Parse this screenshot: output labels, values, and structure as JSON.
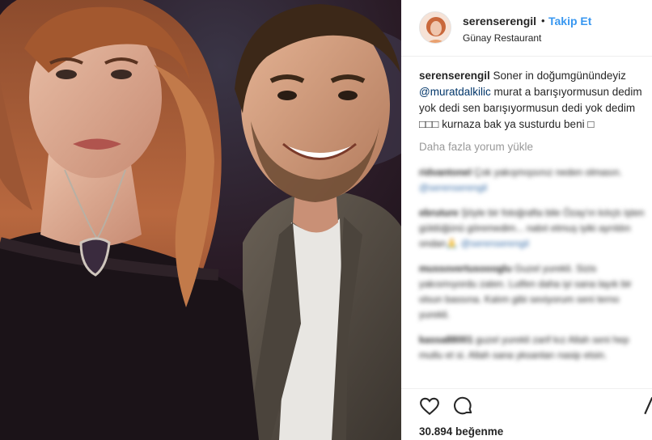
{
  "post": {
    "username": "serenserengil",
    "separator": "•",
    "follow_label": "Takip Et",
    "location": "Günay Restaurant"
  },
  "caption": {
    "username": "serenserengil",
    "text_1": " Soner in doğumgünündeyiz ",
    "mention": "@muratdalkilic",
    "text_2": " murat a barışıyormusun dedim yok dedi sen barışıyormusun dedi yok dedim □□□ kurnaza bak ya susturdu beni □"
  },
  "load_more_label": "Daha fazla yorum yükle",
  "comments": [
    {
      "username": "ridvantoneI",
      "text": " Çok yakışmışsınız neden olmasın. ",
      "mention": "@serenserengil"
    },
    {
      "username": "ebruture",
      "text": " Şöyle bir fotoğrafta bile Özay'ın kılıçtı işten güldüğünü göremedim... nabıt etmuş iyiki ayrıldın ondan🙏 ",
      "mention": "@serenserengil"
    },
    {
      "username": "mussovertusoooglu",
      "text": " Guzel yurekli. Sizis yakısmıyordu zaten. Lutfen daha iyi sana layık bir olsun bassına. Kalım gibi seviyorum seni terno yurekli.",
      "mention": ""
    },
    {
      "username": "kassa88001",
      "text": " guzel yurekli zarif kız Allah seni hep mutlu et si. Allah sana yksanları nasip etsin.",
      "mention": ""
    }
  ],
  "likes_label": "30.894 beğenme",
  "icons": {
    "like": "heart-outline-icon",
    "comment": "comment-bubble-icon",
    "share": "share-icon"
  },
  "colors": {
    "follow": "#3897f0",
    "mention": "#003569",
    "muted": "#999999"
  }
}
